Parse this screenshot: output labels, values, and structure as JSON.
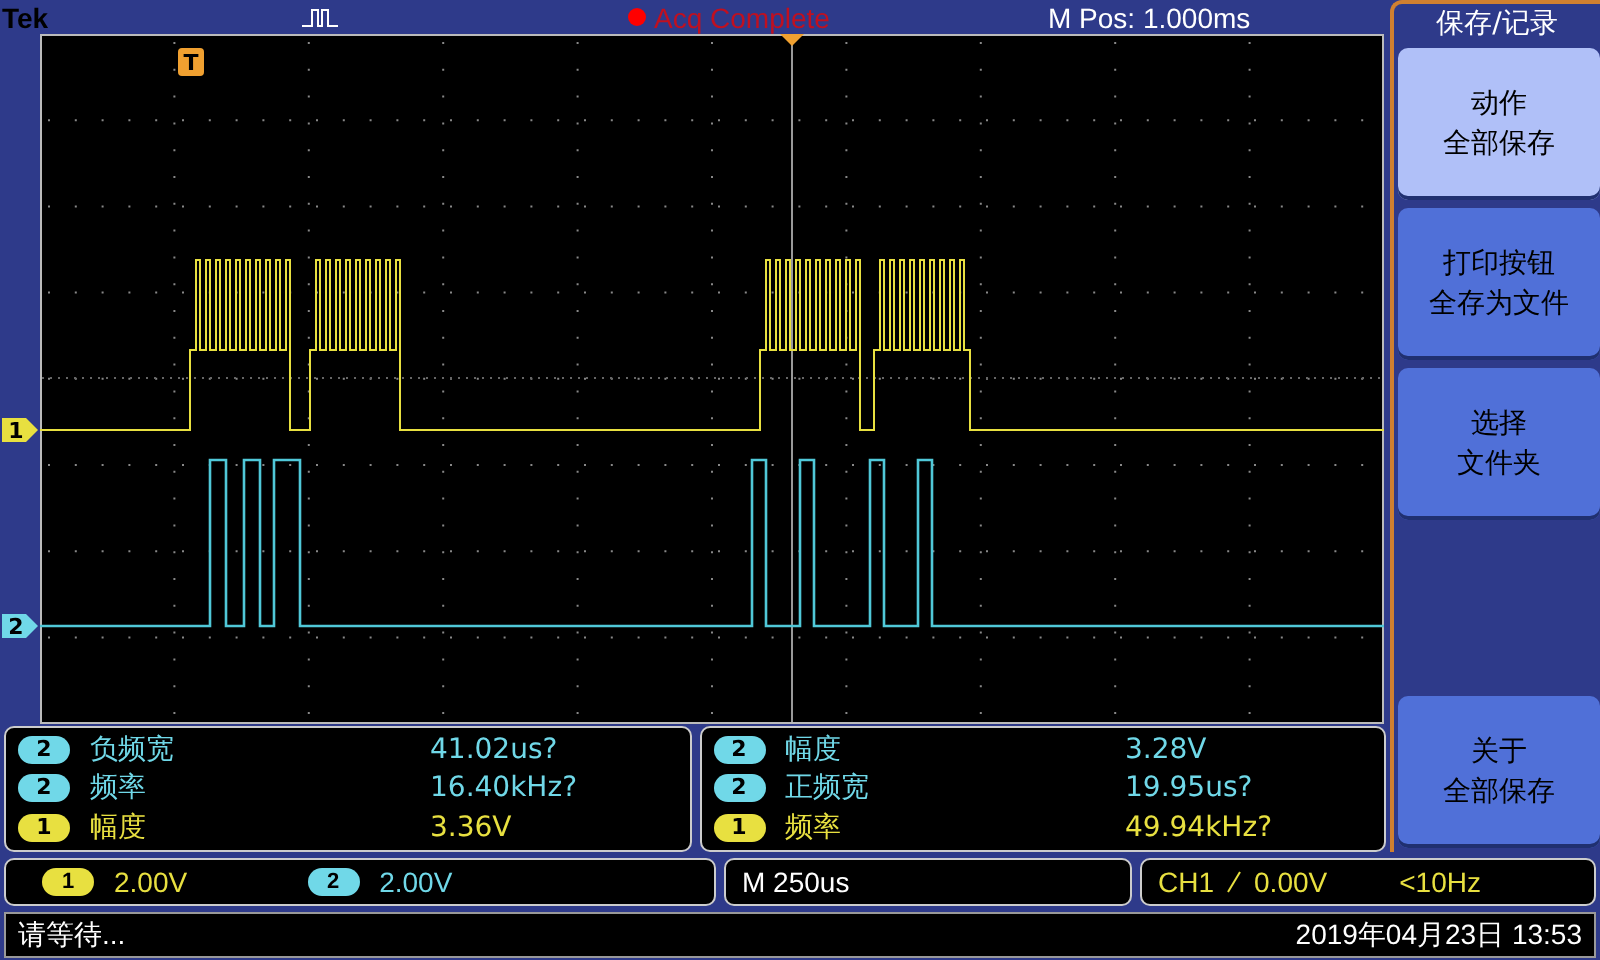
{
  "top_bar": {
    "brand": "Tek",
    "acq_status": "Acq Complete",
    "position": "M Pos: 1.000ms"
  },
  "trigger_marker": "T",
  "channel_markers": [
    {
      "label": "1",
      "color": "#e8e040"
    },
    {
      "label": "2",
      "color": "#70d8e8"
    }
  ],
  "measurement_panels": [
    {
      "rows": [
        {
          "channel": "2",
          "color": "#70d8e8",
          "name": "负频宽",
          "value": "41.02us?"
        },
        {
          "channel": "2",
          "color": "#70d8e8",
          "name": "频率",
          "value": "16.40kHz?"
        },
        {
          "channel": "1",
          "color": "#e8e040",
          "name": "幅度",
          "value": "3.36V"
        }
      ]
    },
    {
      "rows": [
        {
          "channel": "2",
          "color": "#70d8e8",
          "name": "幅度",
          "value": "3.28V"
        },
        {
          "channel": "2",
          "color": "#70d8e8",
          "name": "正频宽",
          "value": "19.95us?"
        },
        {
          "channel": "1",
          "color": "#e8e040",
          "name": "频率",
          "value": "49.94kHz?"
        }
      ]
    }
  ],
  "vertical_settings": [
    {
      "channel": "1",
      "color": "#e8e040",
      "scale": "2.00V"
    },
    {
      "channel": "2",
      "color": "#70d8e8",
      "scale": "2.00V"
    }
  ],
  "timebase": "M 250us",
  "trigger": {
    "source": "CH1",
    "level": "0.00V",
    "frequency": "<10Hz"
  },
  "status": {
    "message": "请等待...",
    "datetime": "2019年04月23日 13:53"
  },
  "menu": {
    "title": "保存/记录",
    "buttons": [
      {
        "lines": [
          "动作",
          "全部保存"
        ],
        "selected": true
      },
      {
        "lines": [
          "打印按钮",
          "全存为文件"
        ],
        "selected": false
      },
      {
        "lines": [
          "选择",
          "文件夹"
        ],
        "selected": false
      },
      {
        "lines": [
          "关于",
          "全部保存"
        ],
        "selected": false
      }
    ]
  }
}
